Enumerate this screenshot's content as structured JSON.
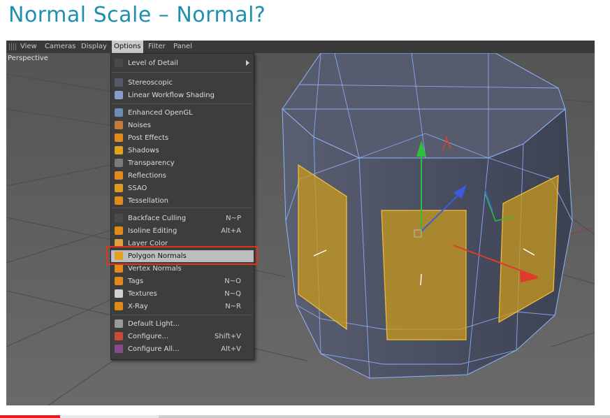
{
  "slide": {
    "title": "Normal Scale – Normal?"
  },
  "viewport": {
    "menubar": [
      "View",
      "Cameras",
      "Display",
      "Options",
      "Filter",
      "Panel"
    ],
    "active_menu": "Options",
    "camera_label": "Perspective"
  },
  "options_menu": {
    "items": [
      {
        "label": "Level of Detail",
        "shortcut": "",
        "submenu": true,
        "icon": "lod-icon",
        "color": "#4a4a4a"
      },
      {
        "label": "Stereoscopic",
        "shortcut": "",
        "icon": "stereoscopic-icon",
        "color": "#555a66"
      },
      {
        "label": "Linear Workflow Shading",
        "shortcut": "",
        "icon": "linear-workflow-icon",
        "color": "#8a9cc8"
      },
      {
        "label": "Enhanced OpenGL",
        "shortcut": "",
        "icon": "enhanced-opengl-icon",
        "color": "#6d8db5"
      },
      {
        "label": "Noises",
        "shortcut": "",
        "icon": "noises-icon",
        "color": "#c97a3a"
      },
      {
        "label": "Post Effects",
        "shortcut": "",
        "icon": "post-effects-icon",
        "color": "#e08a1a"
      },
      {
        "label": "Shadows",
        "shortcut": "",
        "icon": "shadows-icon",
        "color": "#e0a020"
      },
      {
        "label": "Transparency",
        "shortcut": "",
        "icon": "transparency-icon",
        "color": "#7a7a7a"
      },
      {
        "label": "Reflections",
        "shortcut": "",
        "icon": "reflections-icon",
        "color": "#e08a1a"
      },
      {
        "label": "SSAO",
        "shortcut": "",
        "icon": "ssao-icon",
        "color": "#e09a20"
      },
      {
        "label": "Tessellation",
        "shortcut": "",
        "icon": "tessellation-icon",
        "color": "#e08a1a"
      },
      {
        "label": "Backface Culling",
        "shortcut": "N~P",
        "icon": "backface-culling-icon",
        "color": "#4a4a4a"
      },
      {
        "label": "Isoline Editing",
        "shortcut": "Alt+A",
        "icon": "isoline-editing-icon",
        "color": "#e08a1a"
      },
      {
        "label": "Layer Color",
        "shortcut": "",
        "icon": "layer-color-icon",
        "color": "#e0a040"
      },
      {
        "label": "Polygon Normals",
        "shortcut": "",
        "icon": "polygon-normals-icon",
        "color": "#e0a020",
        "highlighted": true
      },
      {
        "label": "Vertex Normals",
        "shortcut": "",
        "icon": "vertex-normals-icon",
        "color": "#e08a1a"
      },
      {
        "label": "Tags",
        "shortcut": "N~O",
        "icon": "tags-icon",
        "color": "#e08a1a"
      },
      {
        "label": "Textures",
        "shortcut": "N~Q",
        "icon": "textures-icon",
        "color": "#d0d0d0"
      },
      {
        "label": "X-Ray",
        "shortcut": "N~R",
        "icon": "xray-icon",
        "color": "#e08a1a"
      },
      {
        "label": "Default Light...",
        "shortcut": "",
        "icon": "default-light-icon",
        "color": "#9a9a9a"
      },
      {
        "label": "Configure...",
        "shortcut": "Shift+V",
        "icon": "configure-icon",
        "color": "#c94a3a"
      },
      {
        "label": "Configure All...",
        "shortcut": "Alt+V",
        "icon": "configure-all-icon",
        "color": "#8a4a8a"
      }
    ]
  },
  "video": {
    "progress": 0.098,
    "buffered": 0.26
  },
  "colors": {
    "accent": "#1f8fb0",
    "highlight_box": "#e2341d",
    "selected_polygon": "#d8a21c"
  }
}
